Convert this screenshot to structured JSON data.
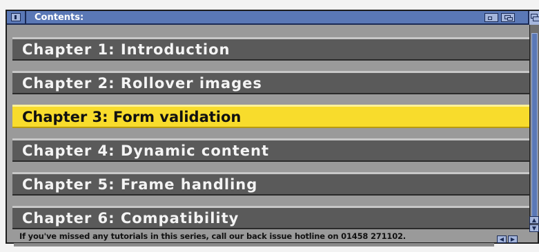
{
  "window": {
    "title": "Contents:"
  },
  "chapters": [
    {
      "label": "Chapter 1: Introduction",
      "selected": false
    },
    {
      "label": "Chapter 2: Rollover images",
      "selected": false
    },
    {
      "label": "Chapter 3: Form validation",
      "selected": true
    },
    {
      "label": "Chapter 4: Dynamic content",
      "selected": false
    },
    {
      "label": "Chapter 5: Frame handling",
      "selected": false
    },
    {
      "label": "Chapter 6: Compatibility",
      "selected": false
    }
  ],
  "footer": {
    "note": "If you've missed any tutorials in this series, call our back issue hotline on 01458 271102."
  },
  "icons": {
    "close": "close-icon",
    "zoom": "zoom-icon",
    "iconify": "iconify-icon",
    "depth": "depth-icon",
    "scroll_up": "arrow-up-icon",
    "scroll_down": "arrow-down-icon",
    "scroll_left": "arrow-left-icon",
    "scroll_right": "arrow-right-icon"
  },
  "colors": {
    "titlebar": "#5a78b6",
    "item_bg": "#5a5a5a",
    "selected_bg": "#f8dc2c",
    "window_bg": "#9a9a9a"
  }
}
